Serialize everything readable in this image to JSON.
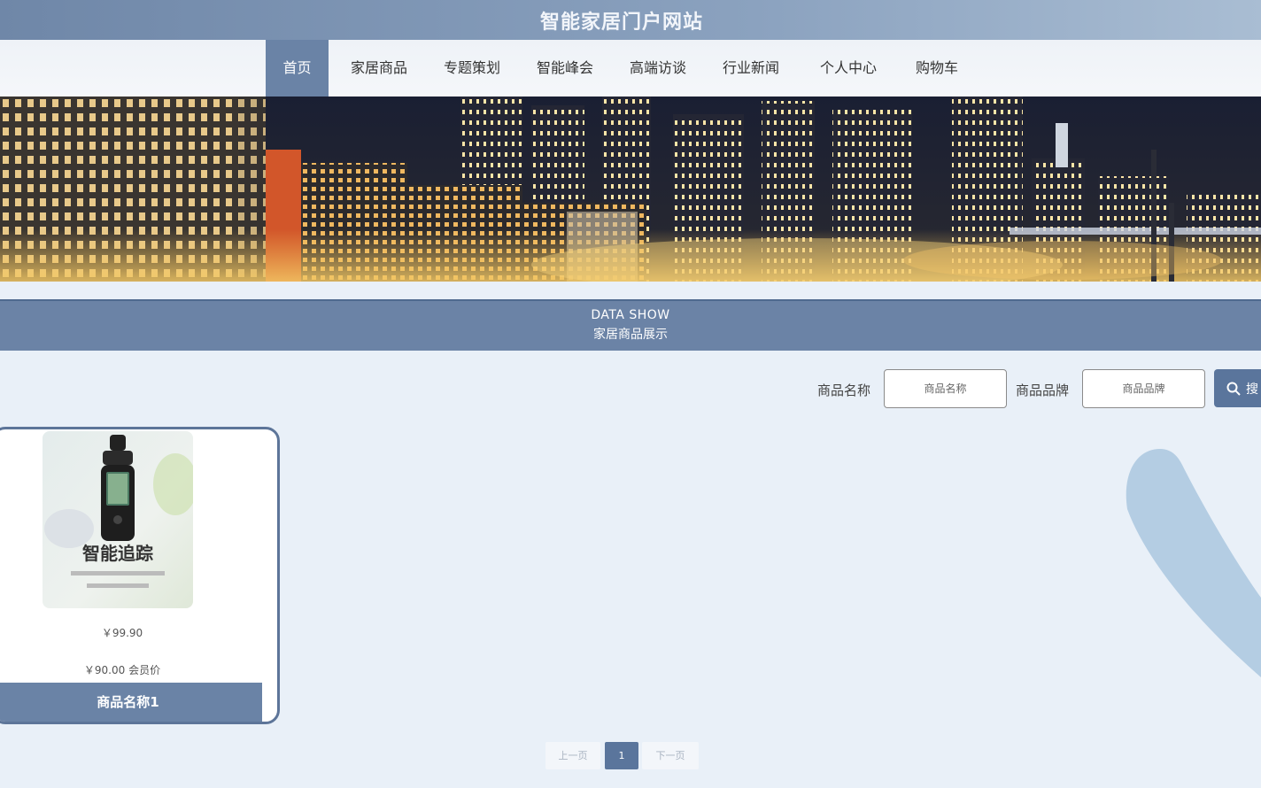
{
  "header": {
    "site_title": "智能家居门户网站"
  },
  "nav": {
    "items": [
      {
        "label": "首页",
        "active": true
      },
      {
        "label": "家居商品"
      },
      {
        "label": "专题策划"
      },
      {
        "label": "智能峰会"
      },
      {
        "label": "高端访谈"
      },
      {
        "label": "行业新闻"
      },
      {
        "label": "个人中心"
      },
      {
        "label": "购物车"
      }
    ]
  },
  "section": {
    "title_en": "DATA SHOW",
    "title_cn": "家居商品展示"
  },
  "search": {
    "name_label": "商品名称",
    "name_placeholder": "商品名称",
    "brand_label": "商品品牌",
    "brand_placeholder": "商品品牌",
    "button_label": "搜"
  },
  "products": [
    {
      "image_title": "智能追踪",
      "price": "￥99.90",
      "member_price": "￥90.00 会员价",
      "name": "商品名称1"
    }
  ],
  "pagination": {
    "prev": "上一页",
    "current": "1",
    "next": "下一页"
  },
  "colors": {
    "accent": "#6a83a6",
    "dark_accent": "#5a759c",
    "background": "#e9f0f8"
  }
}
